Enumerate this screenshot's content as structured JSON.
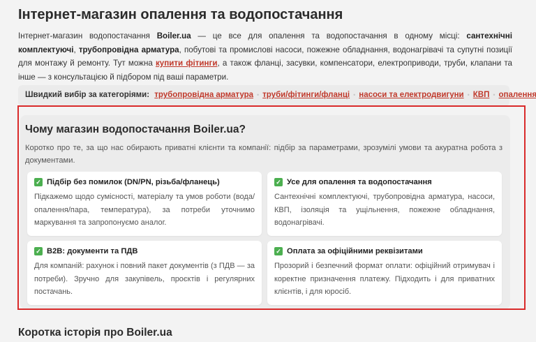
{
  "page": {
    "title": "Інтернет-магазин опалення та водопостачання"
  },
  "intro": {
    "p1": "Інтернет-магазин водопостачання ",
    "brand": "Boiler.ua",
    "p2": " — це все для опалення та водопостачання в одному місці: ",
    "bold1": "сантехнічні комплектуючі",
    "p3": ", ",
    "bold2": "трубопровідна арматура",
    "p4": ", побутові та промислові насоси, пожежне обладнання, водонагрівачі та супутні позиції для монтажу й ремонту. Тут можна ",
    "link": "купити фітинги",
    "p5": ", а також фланці, засувки, компенсатори, електроприводи, труби, клапани та інше — з консультацією й підбором під ваші параметри."
  },
  "quick_nav": {
    "label": "Швидкий вибір за категоріями:",
    "links": [
      "трубопровідна арматура",
      "труби/фітинги/фланці",
      "насоси та електродвигуни",
      "КВП",
      "опалення"
    ]
  },
  "why": {
    "title": "Чому магазин водопостачання Boiler.ua?",
    "subtitle": "Коротко про те, за що нас обирають приватні клієнти та компанії: підбір за параметрами, зрозумілі умови та акуратна робота з документами.",
    "features": [
      {
        "title": "Підбір без помилок (DN/PN, різьба/фланець)",
        "text": "Підкажемо щодо сумісності, матеріалу та умов роботи (вода/опалення/пара, температура), за потреби уточнимо маркування та запропонуємо аналог."
      },
      {
        "title": "Усе для опалення та водопостачання",
        "text": "Сантехнічні комплектуючі, трубопровідна арматура, насоси, КВП, ізоляція та ущільнення, пожежне обладнання, водонагрівачі."
      },
      {
        "title": "B2B: документи та ПДВ",
        "text": "Для компаній: рахунок і повний пакет документів (з ПДВ — за потреби). Зручно для закупівель, проєктів і регулярних постачань."
      },
      {
        "title": "Оплата за офіційними реквізитами",
        "text": "Прозорий і безпечний формат оплати: офіційний отримувач і коректне призначення платежу. Підходить і для приватних клієнтів, і для юросіб."
      }
    ],
    "check_symbol": "✓"
  },
  "history": {
    "title": "Коротка історія про Boiler.ua"
  },
  "colors": {
    "accent_link": "#c0392b",
    "highlight_border": "#d92a2a",
    "check_green": "#4caf50"
  }
}
